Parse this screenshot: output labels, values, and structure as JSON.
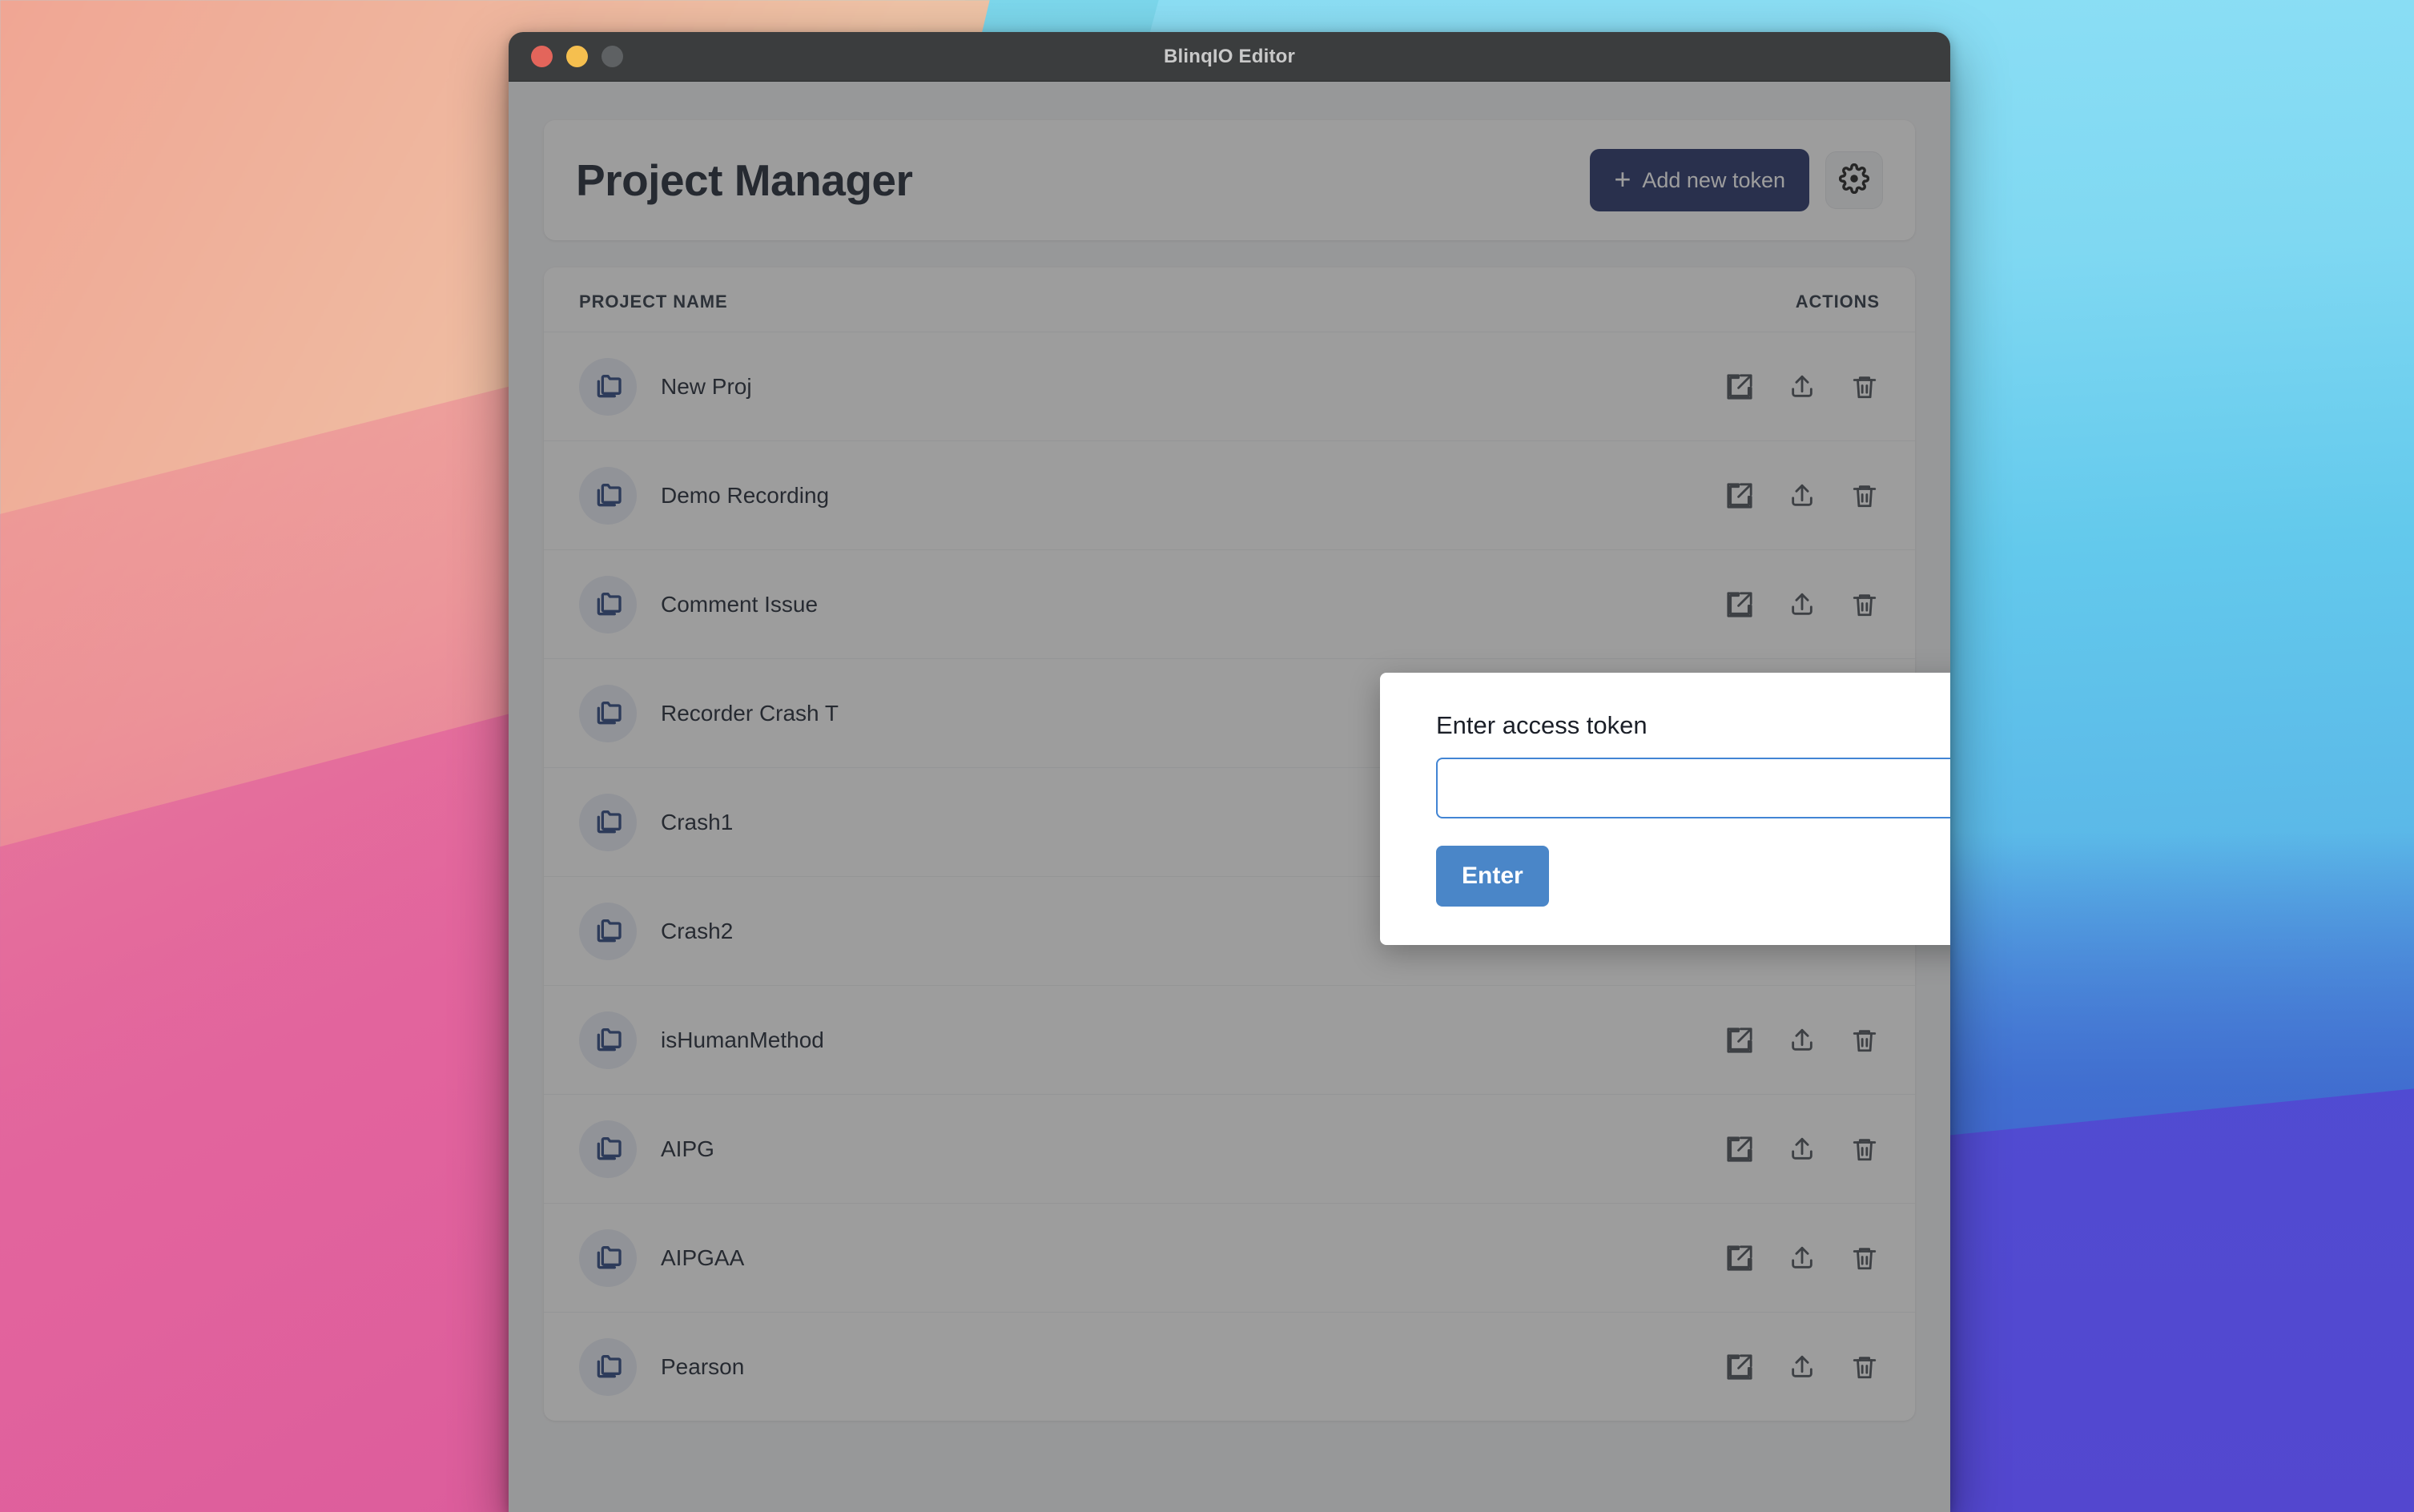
{
  "window": {
    "title": "BlinqIO Editor",
    "traffic_lights": [
      "close",
      "minimize",
      "zoom"
    ]
  },
  "header": {
    "title": "Project Manager",
    "add_token_label": "Add new token",
    "add_token_plus": "+",
    "settings_icon": "gear-icon",
    "accent_navy": "#17255f"
  },
  "list": {
    "columns": {
      "name": "PROJECT NAME",
      "actions": "ACTIONS"
    },
    "row_icon": "folders-icon",
    "action_icons": [
      "external-link-icon",
      "upload-icon",
      "trash-icon"
    ],
    "rows": [
      {
        "name": "New Proj"
      },
      {
        "name": "Demo Recording"
      },
      {
        "name": "Comment Issue"
      },
      {
        "name": "Recorder Crash T"
      },
      {
        "name": "Crash1"
      },
      {
        "name": "Crash2"
      },
      {
        "name": "isHumanMethod"
      },
      {
        "name": "AIPG"
      },
      {
        "name": "AIPGAA"
      },
      {
        "name": "Pearson"
      }
    ]
  },
  "modal": {
    "label": "Enter access token",
    "input_value": "",
    "input_placeholder": "",
    "submit_label": "Enter",
    "accent_blue": "#4a86c8",
    "border_blue": "#4285d4"
  }
}
